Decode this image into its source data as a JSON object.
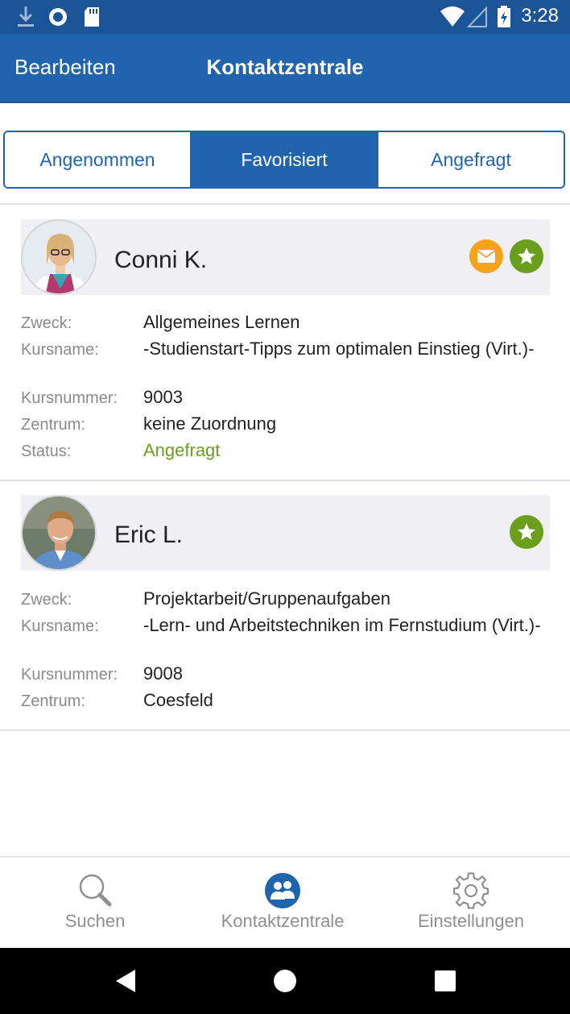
{
  "status_bar": {
    "time": "3:28",
    "icons": [
      "download-icon",
      "sync-icon",
      "sd-card-icon",
      "wifi-icon",
      "cell-signal-icon",
      "battery-icon"
    ]
  },
  "header": {
    "edit_label": "Bearbeiten",
    "title": "Kontaktzentrale"
  },
  "tabs": [
    {
      "label": "Angenommen",
      "active": false
    },
    {
      "label": "Favorisiert",
      "active": true
    },
    {
      "label": "Angefragt",
      "active": false
    }
  ],
  "contacts": [
    {
      "name": "Conni K.",
      "badges": [
        "mail-icon",
        "star-icon"
      ],
      "fields": [
        {
          "label": "Zweck:",
          "value": "Allgemeines Lernen"
        },
        {
          "label": "Kursname:",
          "value": "-Studienstart-Tipps zum optimalen Einstieg (Virt.)-"
        },
        {
          "label": "Kursnummer:",
          "value": "9003"
        },
        {
          "label": "Zentrum:",
          "value": "keine Zuordnung"
        },
        {
          "label": "Status:",
          "value": "Angefragt"
        }
      ]
    },
    {
      "name": "Eric L.",
      "badges": [
        "star-icon"
      ],
      "fields": [
        {
          "label": "Zweck:",
          "value": "Projektarbeit/Gruppenaufgaben"
        },
        {
          "label": "Kursname:",
          "value": "-Lern- und Arbeitstechniken im Fernstudium (Virt.)-"
        },
        {
          "label": "Kursnummer:",
          "value": "9008"
        },
        {
          "label": "Zentrum:",
          "value": "Coesfeld"
        }
      ]
    }
  ],
  "bottom_nav": [
    {
      "label": "Suchen",
      "icon": "search-icon",
      "active": false
    },
    {
      "label": "Kontaktzentrale",
      "icon": "contacts-icon",
      "active": true
    },
    {
      "label": "Einstellungen",
      "icon": "gear-icon",
      "active": false
    }
  ],
  "colors": {
    "primary": "#1f64ad",
    "status_bar": "#1b5598",
    "star": "#6a9f1e",
    "mail": "#f7a21b",
    "status_requested": "#6a9f1e"
  }
}
